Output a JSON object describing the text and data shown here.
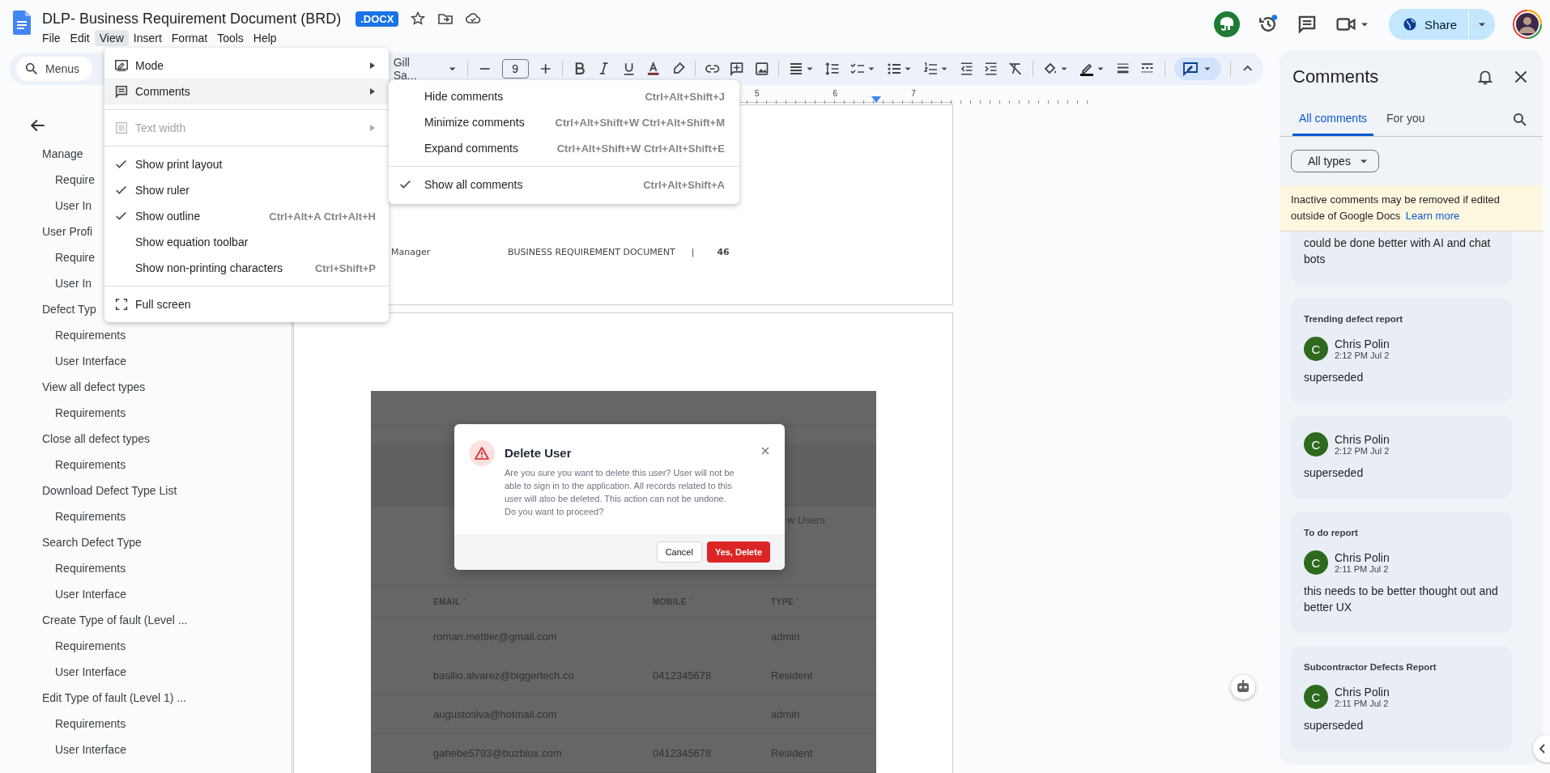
{
  "window": {
    "title": "DLP- Business Requirement Document (BRD)",
    "badge": ".DOCX"
  },
  "menubar": [
    {
      "label": "File",
      "selected": false
    },
    {
      "label": "Edit",
      "selected": false
    },
    {
      "label": "View",
      "selected": true
    },
    {
      "label": "Insert",
      "selected": false
    },
    {
      "label": "Format",
      "selected": false
    },
    {
      "label": "Tools",
      "selected": false
    },
    {
      "label": "Help",
      "selected": false
    }
  ],
  "share_button": "Share",
  "toolbar": {
    "search_placeholder": "Menus",
    "font": "Gill Sa...",
    "font_size": "9"
  },
  "ruler": [
    "5",
    "6",
    "7"
  ],
  "view_menu": [
    {
      "kind": "item",
      "label": "Mode",
      "submenu": true,
      "checked": false,
      "disabled": false,
      "selected": false
    },
    {
      "kind": "item",
      "label": "Comments",
      "submenu": true,
      "checked": false,
      "disabled": false,
      "selected": true
    },
    {
      "kind": "divider"
    },
    {
      "kind": "item",
      "label": "Text width",
      "submenu": true,
      "checked": false,
      "disabled": true,
      "selected": false
    },
    {
      "kind": "divider"
    },
    {
      "kind": "item",
      "label": "Show print layout",
      "submenu": false,
      "checked": true,
      "disabled": false,
      "selected": false
    },
    {
      "kind": "item",
      "label": "Show ruler",
      "submenu": false,
      "checked": true,
      "disabled": false,
      "selected": false
    },
    {
      "kind": "item",
      "label": "Show outline",
      "shortcut": "Ctrl+Alt+A Ctrl+Alt+H",
      "submenu": false,
      "checked": true,
      "disabled": false,
      "selected": false
    },
    {
      "kind": "item",
      "label": "Show equation toolbar",
      "submenu": false,
      "checked": false,
      "disabled": false,
      "selected": false
    },
    {
      "kind": "item",
      "label": "Show non-printing characters",
      "shortcut": "Ctrl+Shift+P",
      "submenu": false,
      "checked": false,
      "disabled": false,
      "selected": false
    },
    {
      "kind": "divider"
    },
    {
      "kind": "item",
      "label": "Full screen",
      "submenu": false,
      "checked": false,
      "disabled": false,
      "selected": false
    }
  ],
  "comments_submenu": [
    {
      "kind": "item",
      "label": "Hide comments",
      "shortcut": "Ctrl+Alt+Shift+J",
      "checked": false
    },
    {
      "kind": "item",
      "label": "Minimize comments",
      "shortcut": "Ctrl+Alt+Shift+W Ctrl+Alt+Shift+M",
      "checked": false
    },
    {
      "kind": "item",
      "label": "Expand comments",
      "shortcut": "Ctrl+Alt+Shift+W Ctrl+Alt+Shift+E",
      "checked": false
    },
    {
      "kind": "divider"
    },
    {
      "kind": "item",
      "label": "Show all comments",
      "shortcut": "Ctrl+Alt+Shift+A",
      "checked": true
    }
  ],
  "outline": {
    "items": [
      {
        "label": "Manage",
        "children": [
          {
            "label": "Require"
          },
          {
            "label": "User In"
          }
        ]
      },
      {
        "label": "User Profi",
        "children": [
          {
            "label": "Require"
          },
          {
            "label": "User In"
          }
        ]
      },
      {
        "label": "Defect Typ",
        "children": [
          {
            "label": "Requirements"
          },
          {
            "label": "User Interface"
          }
        ]
      },
      {
        "label": "View all defect types",
        "children": [
          {
            "label": "Requirements"
          }
        ]
      },
      {
        "label": "Close all defect types",
        "children": [
          {
            "label": "Requirements"
          }
        ]
      },
      {
        "label": "Download Defect Type List",
        "children": [
          {
            "label": "Requirements"
          }
        ]
      },
      {
        "label": "Search Defect Type",
        "children": [
          {
            "label": "Requirements"
          },
          {
            "label": "User Interface"
          }
        ]
      },
      {
        "label": "Create Type of fault (Level ...",
        "children": [
          {
            "label": "Requirements"
          },
          {
            "label": "User Interface"
          }
        ]
      },
      {
        "label": "Edit Type of fault (Level 1) ...",
        "children": [
          {
            "label": "Requirements"
          },
          {
            "label": "User Interface"
          }
        ]
      }
    ]
  },
  "document": {
    "footer": {
      "left": "Manager",
      "title": "BUSINESS REQUIREMENT DOCUMENT",
      "separator": "|",
      "page": "46"
    },
    "screenshot": {
      "button_fragment": "w Users",
      "columns": [
        "EMAIL",
        "MOBILE",
        "TYPE"
      ],
      "rows": [
        [
          "roman.mettler@gmail.com",
          "",
          "admin"
        ],
        [
          "basilio.alvarez@biggertech.co",
          "0412345678",
          "Resident"
        ],
        [
          "augustoslva@hotmail.com",
          "",
          "admin"
        ],
        [
          "gahebe5793@buzblox.com",
          "0412345678",
          "Resident"
        ]
      ],
      "dialog": {
        "title": "Delete User",
        "message": "Are you sure you want to delete this user? User will not be able to sign in to the application. All records related to this user will also be deleted. This action can not be undone. Do you want to proceed?",
        "cancel": "Cancel",
        "confirm": "Yes, Delete"
      }
    }
  },
  "comments_panel": {
    "title": "Comments",
    "tabs": [
      {
        "label": "All comments",
        "selected": true
      },
      {
        "label": "For you",
        "selected": false
      }
    ],
    "filter": "All types",
    "notice": "Inactive comments may be removed if edited outside of Google Docs",
    "notice_link": "Learn more",
    "comments": [
      {
        "text": "could be done better with AI and chat bots"
      },
      {
        "heading": "Trending defect report",
        "initial": "C",
        "author": "Chris Polin",
        "time": "2:12 PM Jul 2",
        "text": "superseded"
      },
      {
        "initial": "C",
        "author": "Chris Polin",
        "time": "2:12 PM Jul 2",
        "text": "superseded"
      },
      {
        "heading": "To do report",
        "initial": "C",
        "author": "Chris Polin",
        "time": "2:11 PM Jul 2",
        "text": "this needs to be better thought out and better UX"
      },
      {
        "heading": "Subcontractor Defects Report",
        "initial": "C",
        "author": "Chris Polin",
        "time": "2:11 PM Jul 2",
        "text": "superseded"
      }
    ]
  }
}
